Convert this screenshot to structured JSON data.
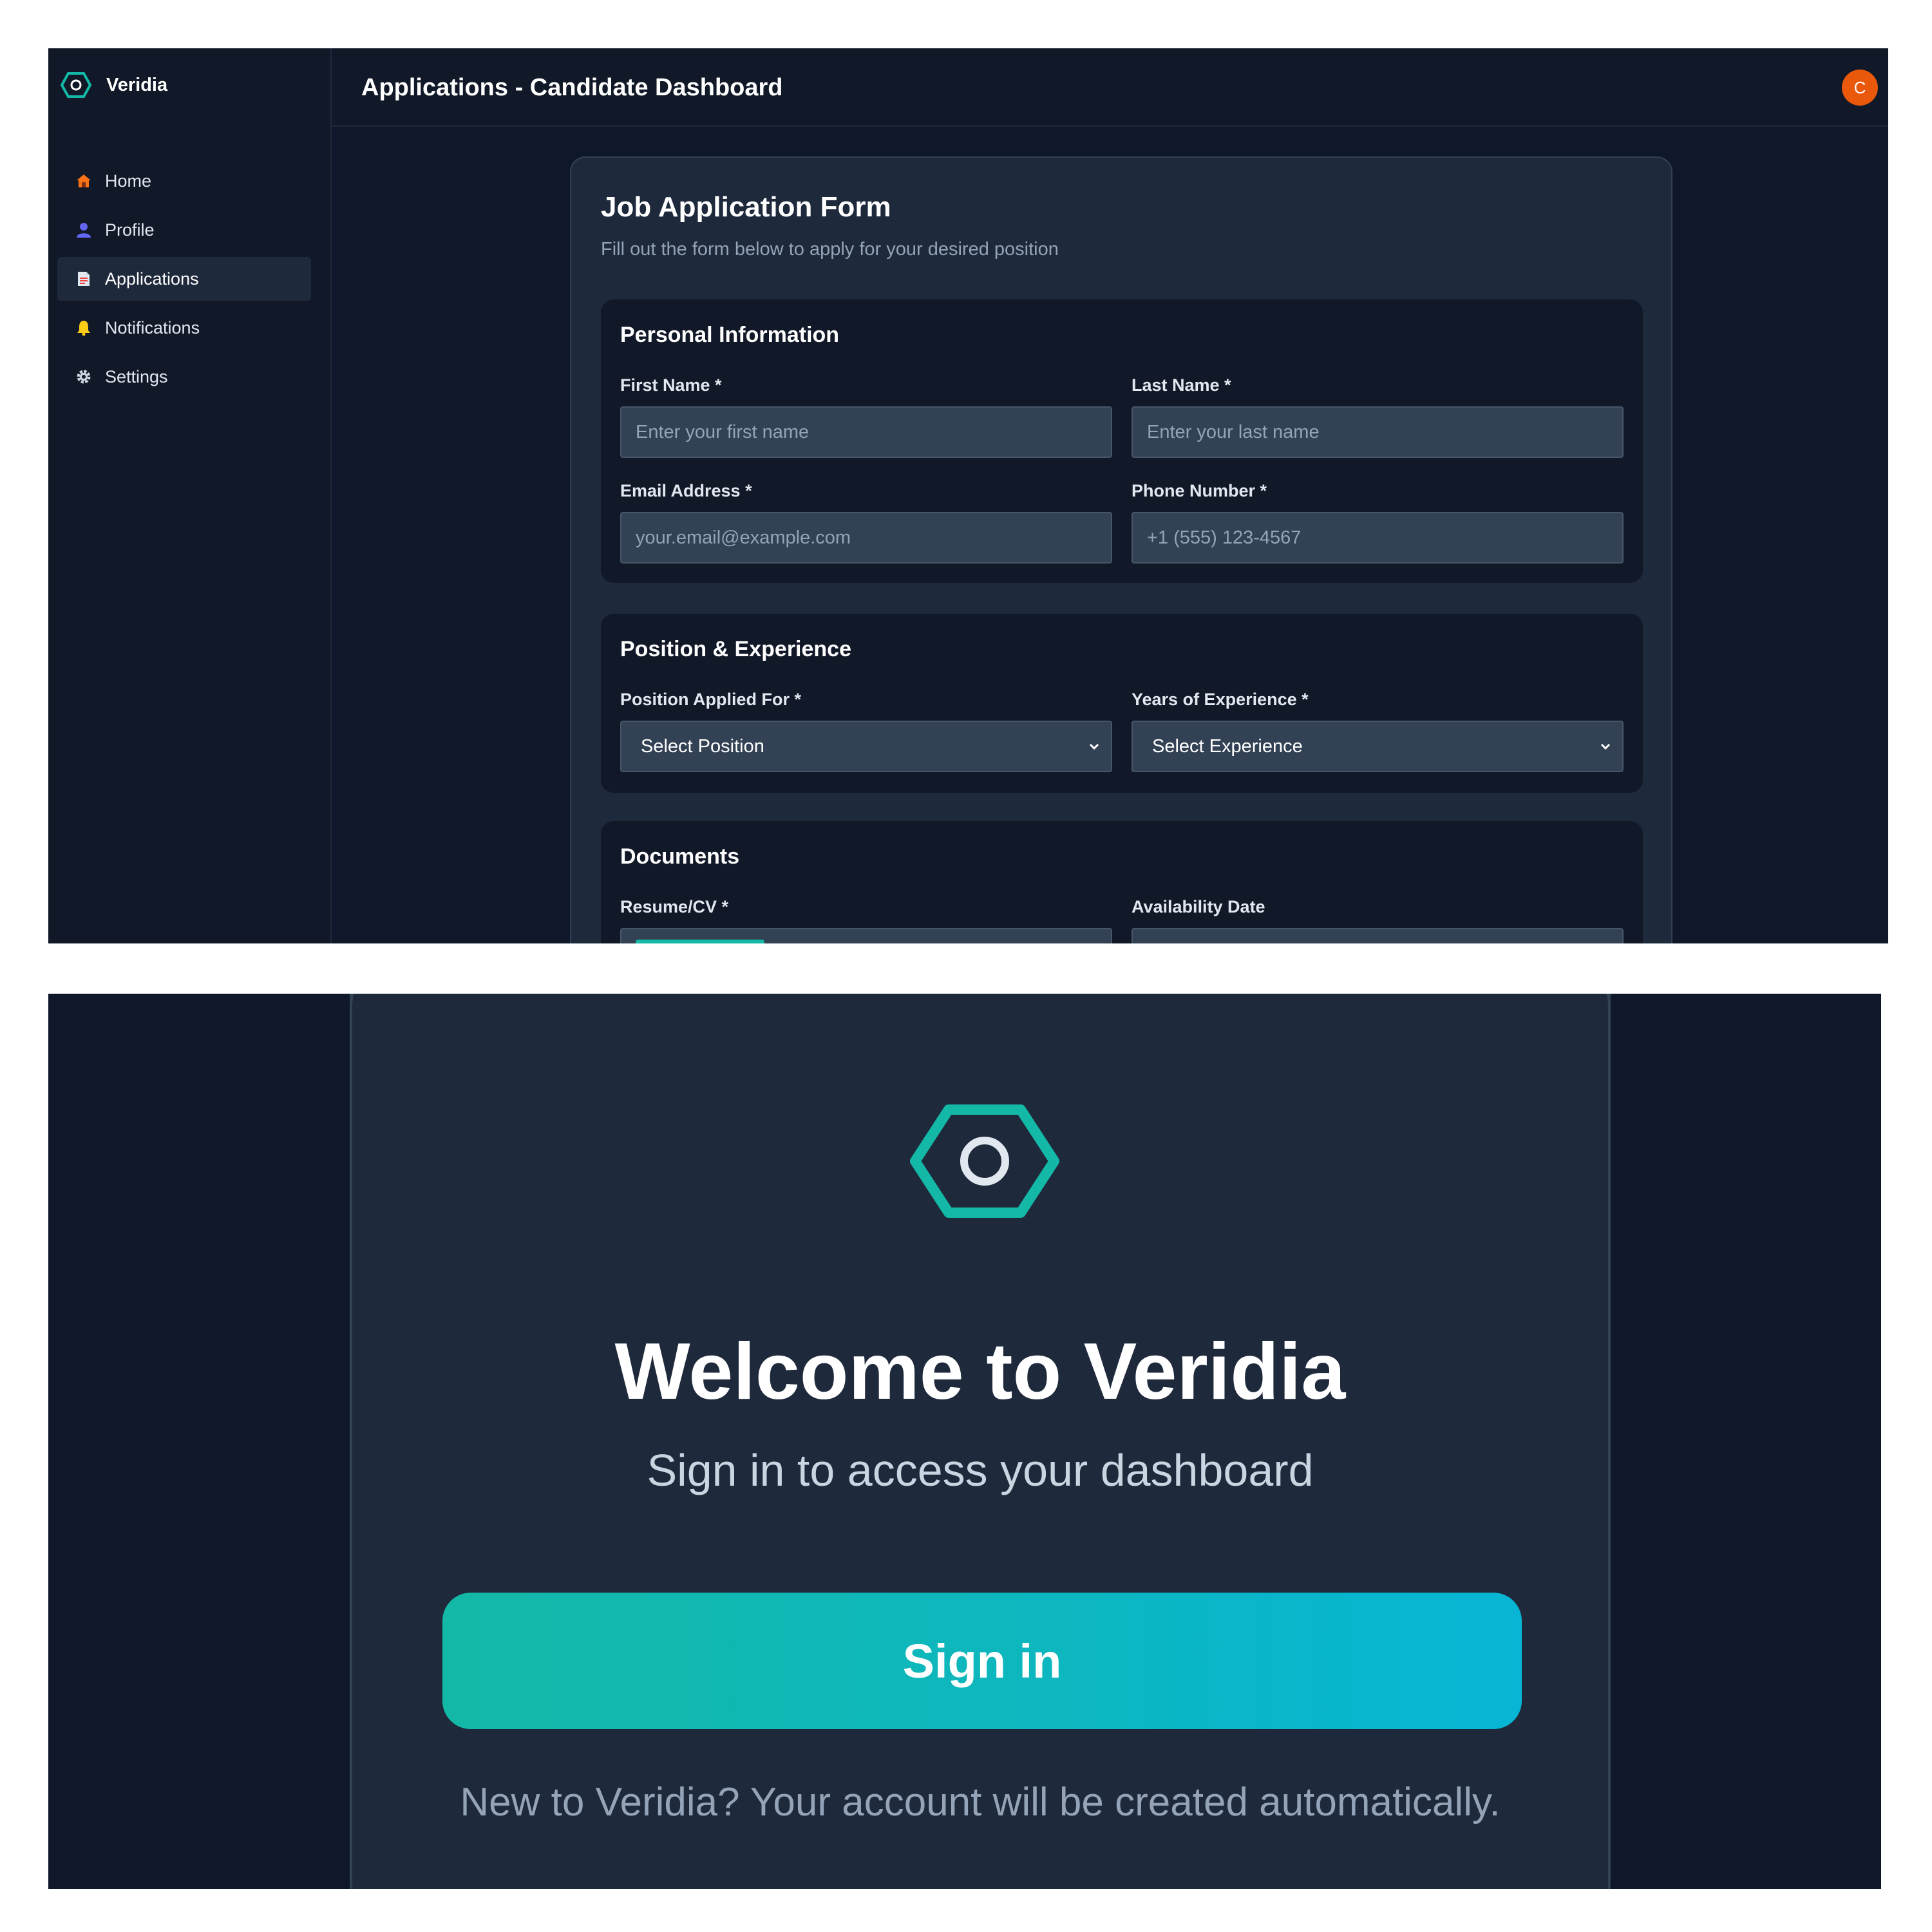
{
  "dashboard": {
    "brand": {
      "name": "Veridia"
    },
    "sidebar": {
      "items": [
        {
          "label": "Home",
          "icon": "home-icon",
          "active": false
        },
        {
          "label": "Profile",
          "icon": "user-icon",
          "active": false
        },
        {
          "label": "Applications",
          "icon": "document-icon",
          "active": true
        },
        {
          "label": "Notifications",
          "icon": "bell-icon",
          "active": false
        },
        {
          "label": "Settings",
          "icon": "gear-icon",
          "active": false
        }
      ]
    },
    "header": {
      "title": "Applications - Candidate Dashboard",
      "avatar_initial": "C"
    },
    "form": {
      "title": "Job Application Form",
      "subtitle": "Fill out the form below to apply for your desired position",
      "personal": {
        "title": "Personal Information",
        "first_name": {
          "label": "First Name *",
          "placeholder": "Enter your first name"
        },
        "last_name": {
          "label": "Last Name *",
          "placeholder": "Enter your last name"
        },
        "email": {
          "label": "Email Address *",
          "placeholder": "your.email@example.com"
        },
        "phone": {
          "label": "Phone Number *",
          "placeholder": "+1 (555) 123-4567"
        }
      },
      "position": {
        "title": "Position & Experience",
        "position_applied": {
          "label": "Position Applied For *",
          "value": "Select Position"
        },
        "years_experience": {
          "label": "Years of Experience *",
          "value": "Select Experience"
        }
      },
      "documents": {
        "title": "Documents",
        "resume": {
          "label": "Resume/CV *"
        },
        "availability": {
          "label": "Availability Date"
        }
      }
    }
  },
  "login": {
    "logo_icon": "hexagon-logo-icon",
    "title": "Welcome to Veridia",
    "subtitle": "Sign in to access your dashboard",
    "signin_label": "Sign in",
    "note": "New to Veridia? Your account will be created automatically."
  },
  "colors": {
    "background": "#0f172a",
    "card": "#1e293b",
    "accent": "#14b8a6",
    "accent_end": "#06b6d4",
    "avatar": "#ea580c"
  }
}
